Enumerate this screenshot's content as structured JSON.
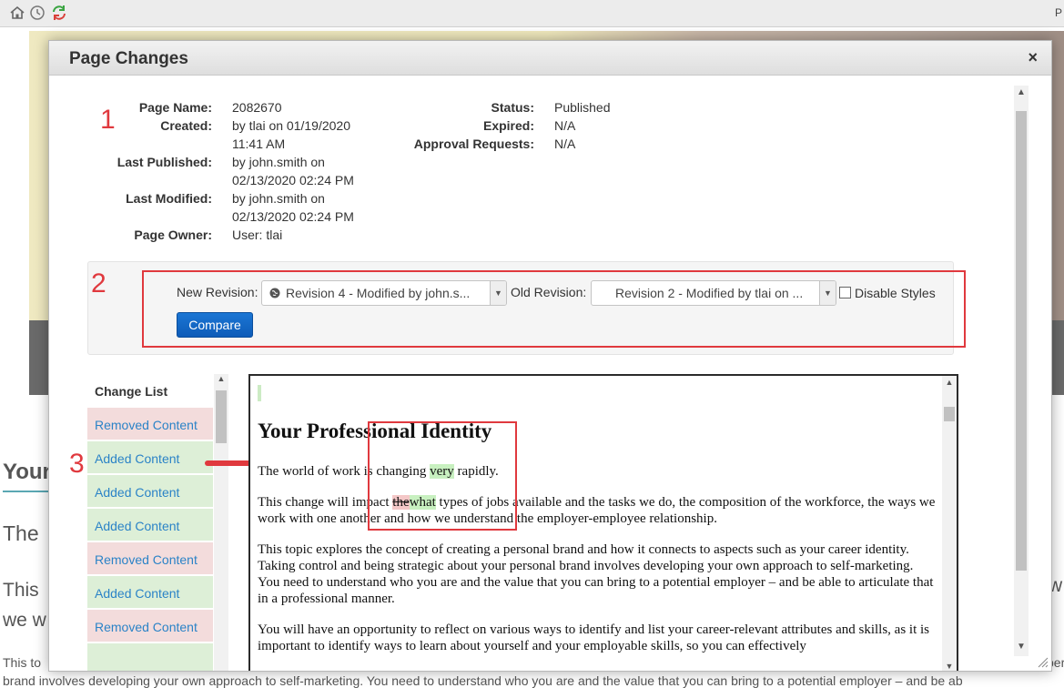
{
  "toolbar": {
    "icons": [
      "home-icon",
      "clock-icon",
      "refresh-icon"
    ],
    "right_text": "P"
  },
  "background": {
    "heading": "Your",
    "sub": "The",
    "para_line1": "This",
    "para_line2": "we w",
    "right_w": "w",
    "small_line1": "This to",
    "small_line2": "brand involves developing your own approach to self-marketing. You need to understand who you are and the value that you can bring to a potential employer – and be ab",
    "small_per": "per"
  },
  "modal": {
    "title": "Page Changes",
    "close": "×"
  },
  "info": {
    "page_name_label": "Page Name:",
    "page_name": "2082670",
    "created_label": "Created:",
    "created_line1": "by tlai on 01/19/2020",
    "created_line2": "11:41 AM",
    "last_published_label": "Last Published:",
    "last_published_line1": "by john.smith on",
    "last_published_line2": "02/13/2020 02:24 PM",
    "last_modified_label": "Last Modified:",
    "last_modified_line1": "by john.smith on",
    "last_modified_line2": "02/13/2020 02:24 PM",
    "page_owner_label": "Page Owner:",
    "page_owner": "User: tlai",
    "status_label": "Status:",
    "status": "Published",
    "expired_label": "Expired:",
    "expired": "N/A",
    "approval_label": "Approval Requests:",
    "approval": "N/A"
  },
  "annotations": {
    "one": "1",
    "two": "2",
    "three": "3",
    "color": "#e0393e"
  },
  "revisions": {
    "new_label": "New Revision:",
    "new_value": "Revision 4 - Modified by john.s...",
    "old_label": "Old Revision:",
    "old_value": "Revision 2 - Modified by tlai on ...",
    "disable_styles": "Disable Styles",
    "compare": "Compare"
  },
  "change_list": {
    "header": "Change List",
    "items": [
      {
        "label": "Removed Content",
        "kind": "removed"
      },
      {
        "label": "Added Content",
        "kind": "added"
      },
      {
        "label": "Added Content",
        "kind": "added"
      },
      {
        "label": "Added Content",
        "kind": "added"
      },
      {
        "label": "Removed Content",
        "kind": "removed"
      },
      {
        "label": "Added Content",
        "kind": "added"
      },
      {
        "label": "Removed Content",
        "kind": "removed"
      }
    ]
  },
  "diff": {
    "heading": "Your Professional Identity",
    "p1_a": "The world of work is changing ",
    "p1_ins": "very",
    "p1_b": " rapidly.",
    "p2_a": "This change will impact ",
    "p2_del": "the",
    "p2_ins": "what",
    "p2_b": " types of jobs available and the tasks we do, the composition of the workforce, the ways we work with one another and how we understand the employer-employee relationship.",
    "p3": "This topic explores the concept of creating a personal brand and how it connects to aspects such as your career identity. Taking control and being strategic about your personal brand involves developing your own approach to self-marketing. You need to understand who you are and the value that you can bring to a potential employer – and be able to articulate that in a professional manner.",
    "p4": "You will have an opportunity to reflect on various ways to identify and list your career-relevant attributes and skills, as it is important to identify ways to learn about yourself and your employable skills, so you can effectively"
  },
  "colors": {
    "added_bg": "#ddefd7",
    "removed_bg": "#f3dcdc",
    "link": "#2b83c7",
    "button": "#0d5cb8"
  }
}
